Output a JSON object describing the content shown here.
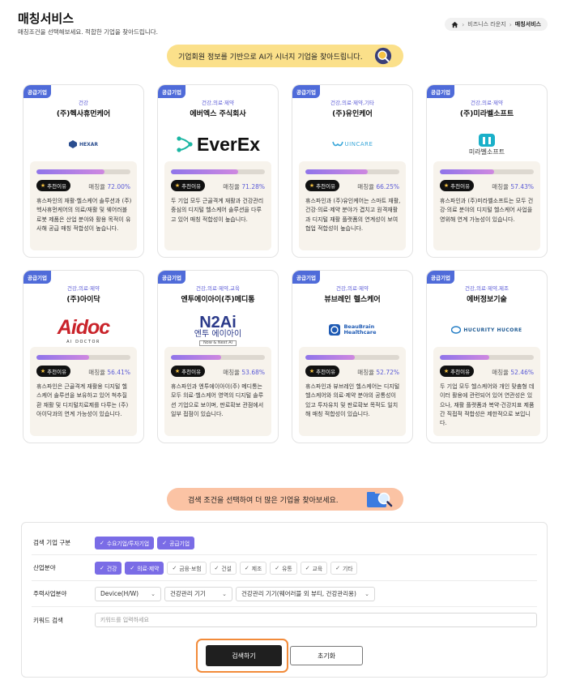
{
  "header": {
    "title": "매칭서비스",
    "subtitle": "매칭조건을 선택해보세요. 적합한 기업을 찾아드립니다.",
    "breadcrumb": [
      "비즈니스 라운지",
      "매칭서비스"
    ]
  },
  "banner_top": "기업회원 정보를 기반으로 AI가 시너지 기업을 찾아드립니다.",
  "banner_bottom": "검색 조건을 선택하여 더 많은 기업을 찾아보세요.",
  "card_common": {
    "badge": "공급기업",
    "reason_label": "추천이유",
    "rate_prefix": "매칭율"
  },
  "cards": [
    {
      "category": "건강",
      "name": "(주)헥사휴먼케어",
      "logo": "HEXAR",
      "rate": 72.0,
      "rate_text": "72.00%",
      "desc": "휴스파인의 재활·헬스케어 솔루션과 (주)헥사휴먼케어의 의료/재활 및 웨어러블 로봇 제품은 산업 분야와 활용 목적이 유사해 공급 매칭 적합성이 높습니다."
    },
    {
      "category": "건강,의료·제약",
      "name": "에버엑스 주식회사",
      "logo": "EverEx",
      "rate": 71.28,
      "rate_text": "71.28%",
      "desc": "두 기업 모두 근골격계 재활과 건강관리 중심의 디지털 헬스케어 솔루션을 다루고 있어 매칭 적합성이 높습니다."
    },
    {
      "category": "건강,의료·제약,기타",
      "name": "(주)유인케어",
      "logo": "UINCARE",
      "rate": 66.25,
      "rate_text": "66.25%",
      "desc": "휴스파인과 (주)유인케어는 스마트 재활, 건강·의료·제약 분야가 겹치고 원격재활과 디지털 재활 플랫폼의 연계성이 보여 협업 적합성이 높습니다."
    },
    {
      "category": "건강,의료·제약",
      "name": "(주)미라벨소프트",
      "logo": "미라벨소프트",
      "rate": 57.43,
      "rate_text": "57.43%",
      "desc": "휴스파인과 (주)미라벨소프트는 모두 건강·의료 분야의 디지털 헬스케어 사업을 영위해 연계 가능성이 있습니다."
    },
    {
      "category": "건강,의료·제약",
      "name": "(주)아이닥",
      "logo": "Aidoc",
      "logo_sub": "AI DOCTOR",
      "rate": 56.41,
      "rate_text": "56.41%",
      "desc": "휴스파인은 근골격계 재활용 디지털 헬스케어 솔루션을 보유하고 있어 척추질환 재활 및 디지털치료제를 다루는 (주)아이닥과의 연계 가능성이 있습니다."
    },
    {
      "category": "건강,의료·제약,교육",
      "name": "엔투에이아이(주)메디통",
      "logo": "N2Ai",
      "logo_sub": "엔투 에이아이",
      "logo_sub2": "Now & Next AI",
      "rate": 53.68,
      "rate_text": "53.68%",
      "desc": "휴스파인과 엔투에이아이(주) 메디통는 모두 의료·헬스케어 영역의 디지털 솔루션 기업으로 보이며, 판로확보 관점에서 일부 접점이 있습니다."
    },
    {
      "category": "건강,의료·제약",
      "name": "뷰브레인 헬스케어",
      "logo": "BeauBrain",
      "logo_sub": "Healthcare",
      "rate": 52.72,
      "rate_text": "52.72%",
      "desc": "휴스파인과 뷰브레인 헬스케어는 디지털 헬스케어와 의료·제약 분야의 공통성이 있고 투자유치 및 판로확보 목적도 일치해 매칭 적합성이 있습니다."
    },
    {
      "category": "건강,의료·제약,제조",
      "name": "에버정보기술",
      "logo": "HUCURITY HUCORE",
      "rate": 52.46,
      "rate_text": "52.46%",
      "desc": "두 기업 모두 헬스케어와 개인 맞춤형 데이터 활용에 관련되어 있어 연관성은 있으나, 재활 플랫폼과 복약·건강지표 제품 간 직접적 적합성은 제한적으로 보입니다."
    }
  ],
  "form": {
    "rows": [
      {
        "label": "검색 기업 구분",
        "options": [
          {
            "text": "수요기업/투자기업",
            "on": true
          },
          {
            "text": "공급기업",
            "on": true
          }
        ]
      },
      {
        "label": "산업분야",
        "options": [
          {
            "text": "건강",
            "on": true
          },
          {
            "text": "의료·제약",
            "on": true
          },
          {
            "text": "금융·보험",
            "on": false
          },
          {
            "text": "건설",
            "on": false
          },
          {
            "text": "제조",
            "on": false
          },
          {
            "text": "유통",
            "on": false
          },
          {
            "text": "교육",
            "on": false
          },
          {
            "text": "기타",
            "on": false
          }
        ]
      }
    ],
    "business_label": "주력사업분야",
    "selects": [
      "Device(H/W)",
      "건강관리 기기",
      "건강관리 기기(웨어러블 외 뷰티, 건강관리용)"
    ],
    "keyword_label": "키워드 검색",
    "keyword_placeholder": "키워드를 입력하세요",
    "search_button": "검색하기",
    "reset_button": "초기화"
  },
  "colors": {
    "accent": "#7a6ce6",
    "badge": "#4f6bd9",
    "banner_top": "#fbe08a",
    "banner_bottom": "#fbc3a4",
    "highlight": "#f28b3a"
  }
}
